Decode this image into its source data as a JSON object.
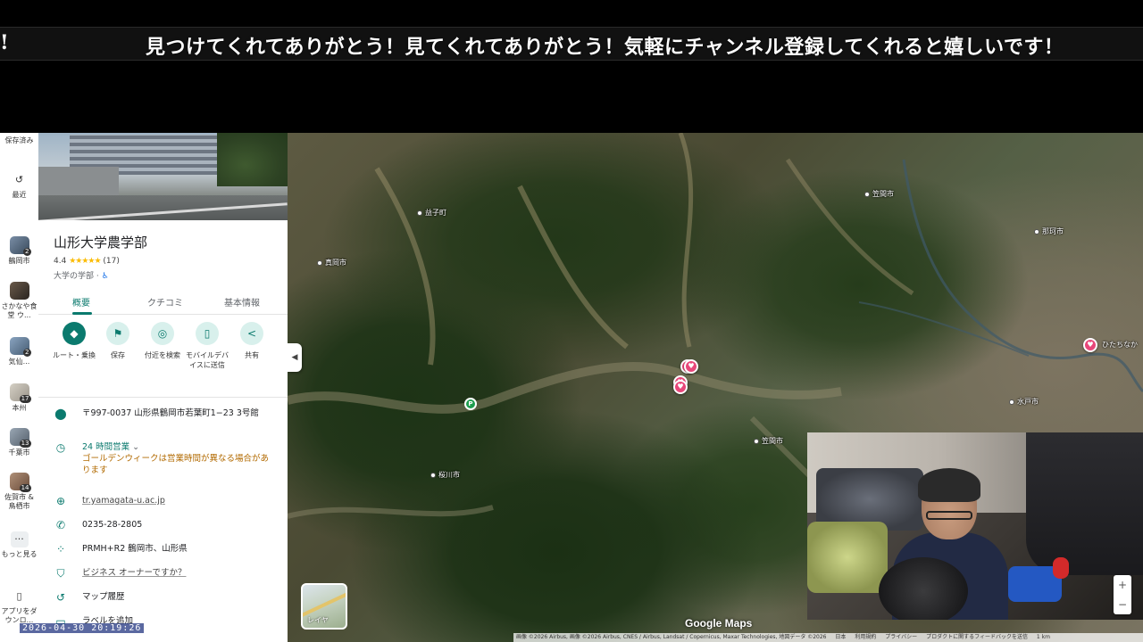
{
  "ticker": {
    "lead": "!",
    "text": "見つけてくれてありがとう！見てくれてありがとう！気軽にチャンネル登録してくれると嬉しいです！"
  },
  "rail": {
    "saved": "保存済み",
    "recent": "最近",
    "items": [
      {
        "label": "鶴岡市",
        "badge": "2"
      },
      {
        "label": "さかなや食堂 ウ...",
        "badge": ""
      },
      {
        "label": "気仙...",
        "badge": "2"
      },
      {
        "label": "本州",
        "badge": "17"
      },
      {
        "label": "千葉市",
        "badge": "13"
      },
      {
        "label": "佐賀市 & 鳥栖市",
        "badge": "14"
      }
    ],
    "more": "もっと見る",
    "app": "アプリをダウンロ..."
  },
  "place": {
    "title": "山形大学農学部",
    "rating": "4.4",
    "stars": "★★★★★",
    "reviews": "(17)",
    "category": "大学の学部 ·",
    "tabs": [
      "概要",
      "クチコミ",
      "基本情報"
    ],
    "actions": [
      {
        "label": "ルート・乗換",
        "icon": "directions-icon"
      },
      {
        "label": "保存",
        "icon": "bookmark-icon"
      },
      {
        "label": "付近を検索",
        "icon": "nearby-icon"
      },
      {
        "label": "モバイルデバイスに送信",
        "icon": "phone-icon"
      },
      {
        "label": "共有",
        "icon": "share-icon"
      }
    ],
    "address": "〒997-0037 山形県鶴岡市若葉町1−23 3号館",
    "hours_status": "24 時間営業",
    "hours_note": "ゴールデンウィークは営業時間が異なる場合があります",
    "website": "tr.yamagata-u.ac.jp",
    "phone": "0235-28-2805",
    "pluscode": "PRMH+R2 鶴岡市、山形県",
    "claim": "ビジネス オーナーですか？",
    "history": "マップ履歴",
    "label_add": "ラベルを追加"
  },
  "map": {
    "labels": [
      "益子町",
      "真岡市",
      "笠間市",
      "那珂市",
      "水戸市",
      "桜川市",
      "笠間市"
    ],
    "pin_label": "ひたちなか",
    "layers": "レイヤ",
    "logo": "Google Maps",
    "attribution": [
      "画像 ©2026 Airbus, 画像 ©2026 Airbus, CNES / Airbus, Landsat / Copernicus, Maxar Technologies, 地図データ ©2026",
      "日本",
      "利用規約",
      "プライバシー",
      "プロダクトに関するフィードバックを送信",
      "1 km"
    ]
  },
  "timestamp": "2026-04-30  20:19:26"
}
